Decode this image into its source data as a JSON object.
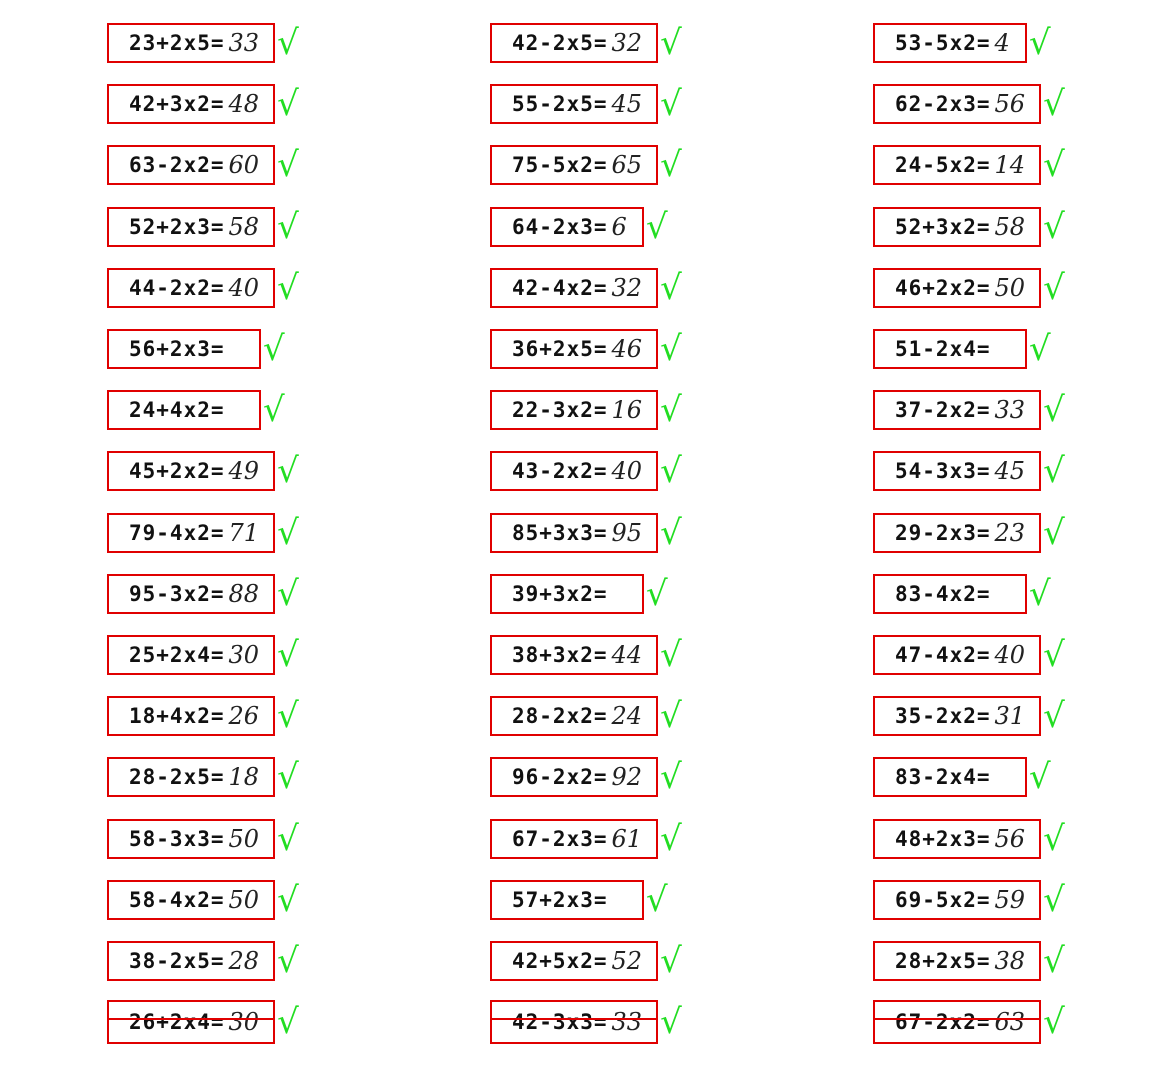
{
  "columns": [
    {
      "problems": [
        {
          "expr": "23+2x5=",
          "answer": "33",
          "mark": "√"
        },
        {
          "expr": "42+3x2=",
          "answer": "48",
          "mark": "√"
        },
        {
          "expr": "63-2x2=",
          "answer": "60",
          "mark": "√"
        },
        {
          "expr": "52+2x3=",
          "answer": "58",
          "mark": "√"
        },
        {
          "expr": "44-2x2=",
          "answer": "40",
          "mark": "√"
        },
        {
          "expr": "56+2x3=",
          "answer": "",
          "mark": "√"
        },
        {
          "expr": "24+4x2=",
          "answer": "",
          "mark": "√"
        },
        {
          "expr": "45+2x2=",
          "answer": "49",
          "mark": "√"
        },
        {
          "expr": "79-4x2=",
          "answer": "71",
          "mark": "√"
        },
        {
          "expr": "95-3x2=",
          "answer": "88",
          "mark": "√"
        },
        {
          "expr": "25+2x4=",
          "answer": "30",
          "mark": "√"
        },
        {
          "expr": "18+4x2=",
          "answer": "26",
          "mark": "√"
        },
        {
          "expr": "28-2x5=",
          "answer": "18",
          "mark": "√"
        },
        {
          "expr": "58-3x3=",
          "answer": "50",
          "mark": "√"
        },
        {
          "expr": "58-4x2=",
          "answer": "50",
          "mark": "√"
        },
        {
          "expr": "38-2x5=",
          "answer": "28",
          "mark": "√"
        },
        {
          "expr": "26+2x4=",
          "answer": "30",
          "mark": "√"
        }
      ]
    },
    {
      "problems": [
        {
          "expr": "42-2x5=",
          "answer": "32",
          "mark": "√"
        },
        {
          "expr": "55-2x5=",
          "answer": "45",
          "mark": "√"
        },
        {
          "expr": "75-5x2=",
          "answer": "65",
          "mark": "√"
        },
        {
          "expr": "64-2x3=",
          "answer": "6",
          "mark": "√"
        },
        {
          "expr": "42-4x2=",
          "answer": "32",
          "mark": "√"
        },
        {
          "expr": "36+2x5=",
          "answer": "46",
          "mark": "√"
        },
        {
          "expr": "22-3x2=",
          "answer": "16",
          "mark": "√"
        },
        {
          "expr": "43-2x2=",
          "answer": "40",
          "mark": "√"
        },
        {
          "expr": "85+3x3=",
          "answer": "95",
          "mark": "√"
        },
        {
          "expr": "39+3x2=",
          "answer": "",
          "mark": "√"
        },
        {
          "expr": "38+3x2=",
          "answer": "44",
          "mark": "√"
        },
        {
          "expr": "28-2x2=",
          "answer": "24",
          "mark": "√"
        },
        {
          "expr": "96-2x2=",
          "answer": "92",
          "mark": "√"
        },
        {
          "expr": "67-2x3=",
          "answer": "61",
          "mark": "√"
        },
        {
          "expr": "57+2x3=",
          "answer": "",
          "mark": "√"
        },
        {
          "expr": "42+5x2=",
          "answer": "52",
          "mark": "√"
        },
        {
          "expr": "42-3x3=",
          "answer": "33",
          "mark": "√"
        }
      ]
    },
    {
      "problems": [
        {
          "expr": "53-5x2=",
          "answer": "4",
          "mark": "√"
        },
        {
          "expr": "62-2x3=",
          "answer": "56",
          "mark": "√"
        },
        {
          "expr": "24-5x2=",
          "answer": "14",
          "mark": "√"
        },
        {
          "expr": "52+3x2=",
          "answer": "58",
          "mark": "√"
        },
        {
          "expr": "46+2x2=",
          "answer": "50",
          "mark": "√"
        },
        {
          "expr": "51-2x4=",
          "answer": "",
          "mark": "√"
        },
        {
          "expr": "37-2x2=",
          "answer": "33",
          "mark": "√"
        },
        {
          "expr": "54-3x3=",
          "answer": "45",
          "mark": "√"
        },
        {
          "expr": "29-2x3=",
          "answer": "23",
          "mark": "√"
        },
        {
          "expr": "83-4x2=",
          "answer": "",
          "mark": "√"
        },
        {
          "expr": "47-4x2=",
          "answer": "40",
          "mark": "√"
        },
        {
          "expr": "35-2x2=",
          "answer": "31",
          "mark": "√"
        },
        {
          "expr": "83-2x4=",
          "answer": "",
          "mark": "√"
        },
        {
          "expr": "48+2x3=",
          "answer": "56",
          "mark": "√"
        },
        {
          "expr": "69-5x2=",
          "answer": "59",
          "mark": "√"
        },
        {
          "expr": "28+2x5=",
          "answer": "38",
          "mark": "√"
        },
        {
          "expr": "67-2x2=",
          "answer": "63",
          "mark": "√"
        }
      ]
    }
  ]
}
